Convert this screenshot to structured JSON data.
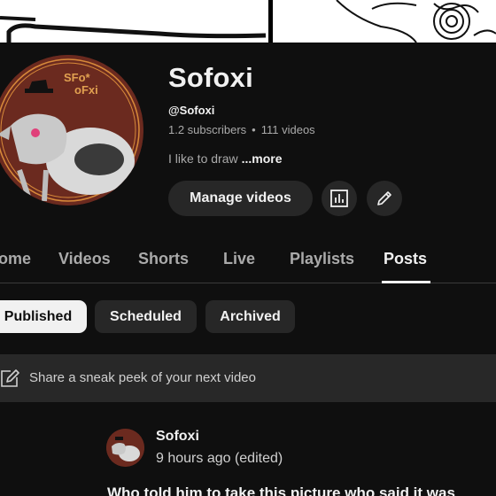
{
  "channel": {
    "name": "Sofoxi",
    "handle": "@Sofoxi",
    "subscribers": "1.2 subscribers",
    "separator": "•",
    "videos": "111 videos",
    "description": "I like to draw",
    "more_label": "...more",
    "avatar_text": "SFo*oFxi"
  },
  "actions": {
    "manage_videos": "Manage videos",
    "analytics_icon": "analytics-icon",
    "edit_icon": "pencil-icon"
  },
  "tabs": [
    {
      "label": "ome",
      "active": false
    },
    {
      "label": "Videos",
      "active": false
    },
    {
      "label": "Shorts",
      "active": false
    },
    {
      "label": "Live",
      "active": false
    },
    {
      "label": "Playlists",
      "active": false
    },
    {
      "label": "Posts",
      "active": true
    }
  ],
  "chips": [
    {
      "label": "Published",
      "active": true
    },
    {
      "label": "Scheduled",
      "active": false
    },
    {
      "label": "Archived",
      "active": false
    }
  ],
  "share": {
    "placeholder": "Share a sneak peek of your next video",
    "icon": "edit-square-icon"
  },
  "post": {
    "author": "Sofoxi",
    "time": "9 hours ago (edited)",
    "text": "Who told him to take this picture who said it was"
  },
  "colors": {
    "background": "#0f0f0f",
    "surface": "#272727",
    "share_bar": "#282828",
    "text_primary": "#f1f1f1",
    "text_secondary": "#aaaaaa",
    "avatar_ring": "#6b2a1f"
  }
}
